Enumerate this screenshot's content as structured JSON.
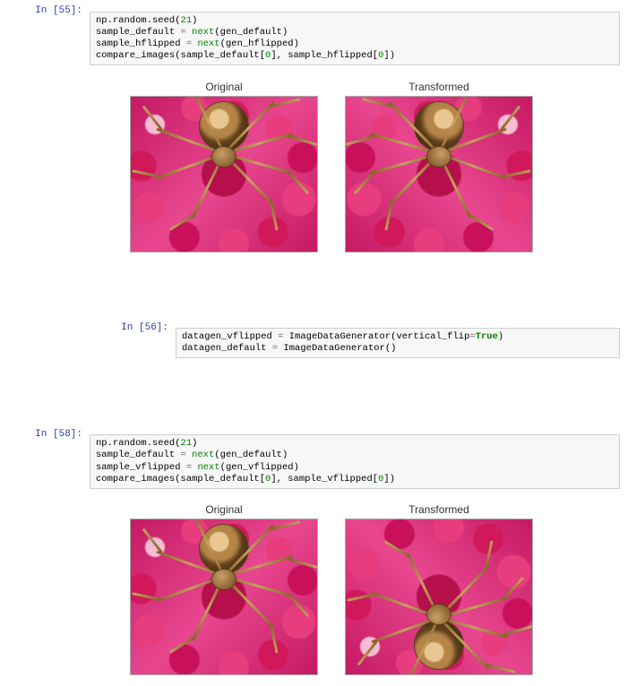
{
  "cells": {
    "c55": {
      "prompt": "In [55]:",
      "code_html": "np.random.seed(<span class='tok-num'>21</span>)\nsample_default <span class='tok-op'>=</span> <span class='tok-built'>next</span>(gen_default)\nsample_hflipped <span class='tok-op'>=</span> <span class='tok-built'>next</span>(gen_hflipped)\ncompare_images(sample_default[<span class='tok-num'>0</span>], sample_hflipped[<span class='tok-num'>0</span>])"
    },
    "c56": {
      "prompt": "In [56]:",
      "code_html": "datagen_vflipped <span class='tok-op'>=</span> ImageDataGenerator(vertical_flip<span class='tok-op'>=</span><span class='tok-kw'>True</span>)\ndatagen_default <span class='tok-op'>=</span> ImageDataGenerator()"
    },
    "c58": {
      "prompt": "In [58]:",
      "code_html": "np.random.seed(<span class='tok-num'>21</span>)\nsample_default <span class='tok-op'>=</span> <span class='tok-built'>next</span>(gen_default)\nsample_vflipped <span class='tok-op'>=</span> <span class='tok-built'>next</span>(gen_vflipped)\ncompare_images(sample_default[<span class='tok-num'>0</span>], sample_vflipped[<span class='tok-num'>0</span>])"
    }
  },
  "titles": {
    "original": "Original",
    "transformed": "Transformed"
  }
}
